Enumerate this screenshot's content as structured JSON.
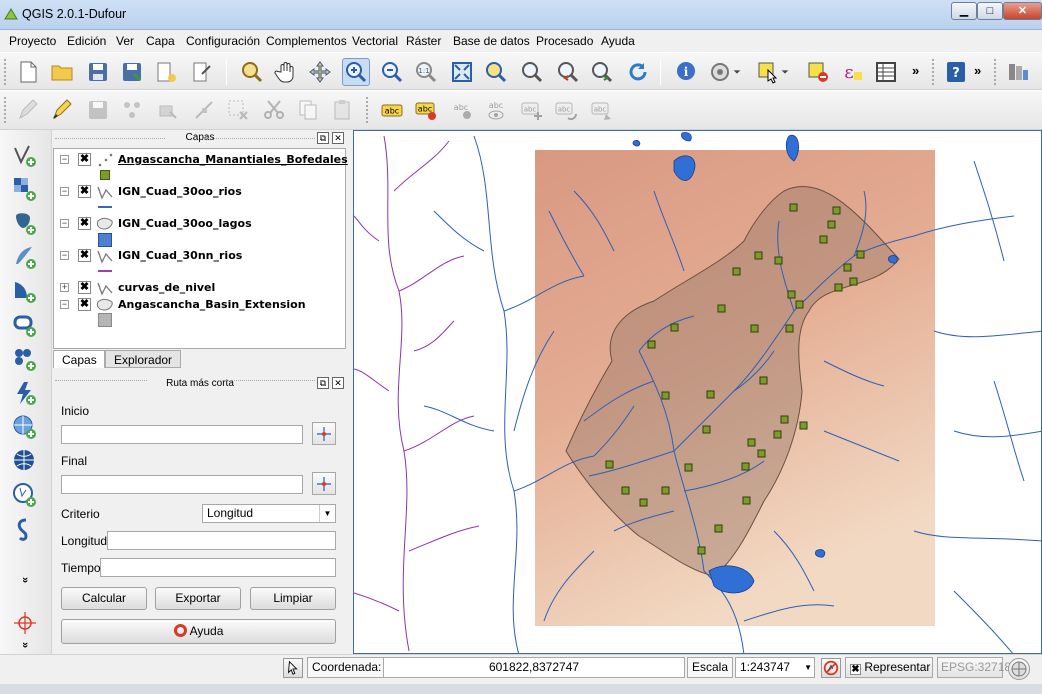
{
  "window": {
    "title": "QGIS 2.0.1-Dufour",
    "min_glyph": "▁",
    "max_glyph": "□",
    "close_glyph": "✕"
  },
  "menu": [
    "Proyecto",
    "Edición",
    "Ver",
    "Capa",
    "Configuración",
    "Complementos",
    "Vectorial",
    "Ráster",
    "Base de datos",
    "Procesado",
    "Ayuda"
  ],
  "toolbar_more": "»",
  "layers_panel": {
    "title": "Capas",
    "float_glyph": "⧉",
    "close_glyph": "✕",
    "layers": [
      {
        "name": "Angascancha_Manantiales_Bofedales",
        "expanded": true,
        "checked": true,
        "type": "point",
        "legend_color": "#6b8e23",
        "selected": true
      },
      {
        "name": "IGN_Cuad_30oo_rios",
        "expanded": true,
        "checked": true,
        "type": "line",
        "legend_color": "#3a63c8",
        "selected": false
      },
      {
        "name": "IGN_Cuad_30oo_lagos",
        "expanded": true,
        "checked": true,
        "type": "polygon",
        "legend_color": "#4f7fd1",
        "selected": false
      },
      {
        "name": "IGN_Cuad_30nn_rios",
        "expanded": true,
        "checked": true,
        "type": "line",
        "legend_color": "#9a3fb6",
        "selected": false
      },
      {
        "name": "curvas_de_nivel",
        "expanded": false,
        "checked": true,
        "type": "line",
        "legend_color": "",
        "selected": false
      },
      {
        "name": "Angascancha_Basin_Extension",
        "expanded": true,
        "checked": true,
        "type": "polygon",
        "legend_color": "#b5b5b5",
        "selected": false
      }
    ],
    "expand_glyph_open": "−",
    "expand_glyph_closed": "+",
    "check_glyph": "✖",
    "tabs": [
      "Capas",
      "Explorador"
    ]
  },
  "route_panel": {
    "title": "Ruta más corta",
    "inicio_label": "Inicio",
    "inicio_value": "",
    "final_label": "Final",
    "final_value": "",
    "criterio_label": "Criterio",
    "criterio_value": "Longitud",
    "longitud_label": "Longitud",
    "longitud_value": "",
    "tiempo_label": "Tiempo",
    "tiempo_value": "",
    "calcular": "Calcular",
    "exportar": "Exportar",
    "limpiar": "Limpiar",
    "ayuda": "Ayuda"
  },
  "vtool_more": "»",
  "statusbar": {
    "coord_label": "Coordenada:",
    "coord_value": "601822,8372747",
    "scale_label": "Escala",
    "scale_value": "1:243747",
    "render_label": "Representar",
    "render_checked": true,
    "epsg": "EPSG:32718"
  },
  "colors": {
    "accent": "#3a6ea5",
    "river": "#2b5fb8",
    "river_nn": "#8c34b0",
    "lake": "#2f6fd6",
    "spring": "#7d9a2a"
  }
}
